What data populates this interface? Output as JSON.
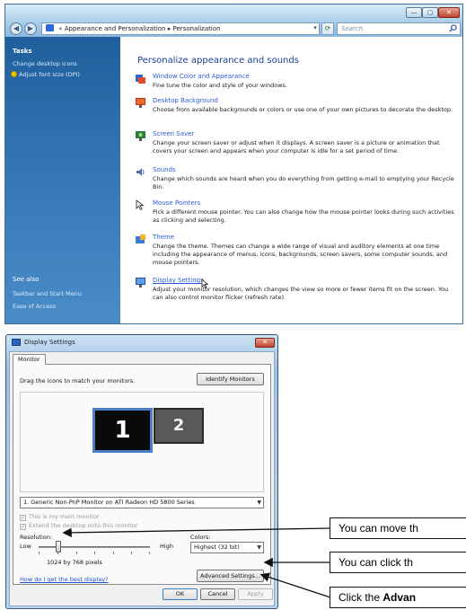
{
  "personalization_window": {
    "breadcrumb": [
      "Appearance and Personalization",
      "Personalization"
    ],
    "search_placeholder": "Search",
    "sidebar": {
      "tasks_heading": "Tasks",
      "tasks": [
        "Change desktop icons",
        "Adjust font size (DPI)"
      ],
      "see_also_heading": "See also",
      "see_also": [
        "Taskbar and Start Menu",
        "Ease of Access"
      ]
    },
    "heading": "Personalize appearance and sounds",
    "items": [
      {
        "title": "Window Color and Appearance",
        "icon": "window-color-icon",
        "description": "Fine tune the color and style of your windows."
      },
      {
        "title": "Desktop Background",
        "icon": "desktop-background-icon",
        "description": "Choose from available backgrounds or colors or use one of your own pictures to decorate the desktop."
      },
      {
        "title": "Screen Saver",
        "icon": "screen-saver-icon",
        "description": "Change your screen saver or adjust when it displays. A screen saver is a picture or animation that covers your screen and appears when your computer is idle for a set period of time."
      },
      {
        "title": "Sounds",
        "icon": "sounds-icon",
        "description": "Change which sounds are heard when you do everything from getting e-mail to emptying your Recycle Bin."
      },
      {
        "title": "Mouse Pointers",
        "icon": "mouse-pointers-icon",
        "description": "Pick a different mouse pointer. You can also change how the mouse pointer looks during such activities as clicking and selecting."
      },
      {
        "title": "Theme",
        "icon": "theme-icon",
        "description": "Change the theme. Themes can change a wide range of visual and auditory elements at one time including the appearance of menus, icons, backgrounds, screen savers, some computer sounds, and mouse pointers."
      },
      {
        "title": "Display Settings",
        "icon": "display-settings-icon",
        "description": "Adjust your monitor resolution, which changes the view so more or fewer items fit on the screen. You can also control monitor flicker (refresh rate)."
      }
    ]
  },
  "display_settings": {
    "title": "Display Settings",
    "tab": "Monitor",
    "drag_hint": "Drag the icons to match your monitors.",
    "identify_button": "Identify Monitors",
    "monitor_1_label": "1",
    "monitor_2_label": "2",
    "monitor_select": "1. Generic Non-PnP Monitor on ATI Radeon HD 5800 Series",
    "main_monitor_label": "This is my main monitor",
    "extend_desktop_label": "Extend the desktop onto this monitor",
    "resolution_label": "Resolution:",
    "resolution_low": "Low",
    "resolution_high": "High",
    "resolution_value": "1024 by 768 pixels",
    "colors_label": "Colors:",
    "colors_value": "Highest (32 bit)",
    "help_link": "How do I get the best display?",
    "advanced_button": "Advanced Settings...",
    "ok_button": "OK",
    "cancel_button": "Cancel",
    "apply_button": "Apply"
  },
  "callouts": {
    "c1": "You can move th",
    "c2": "You can click th",
    "c3_pre": "Click the ",
    "c3_bold": "Advan"
  }
}
